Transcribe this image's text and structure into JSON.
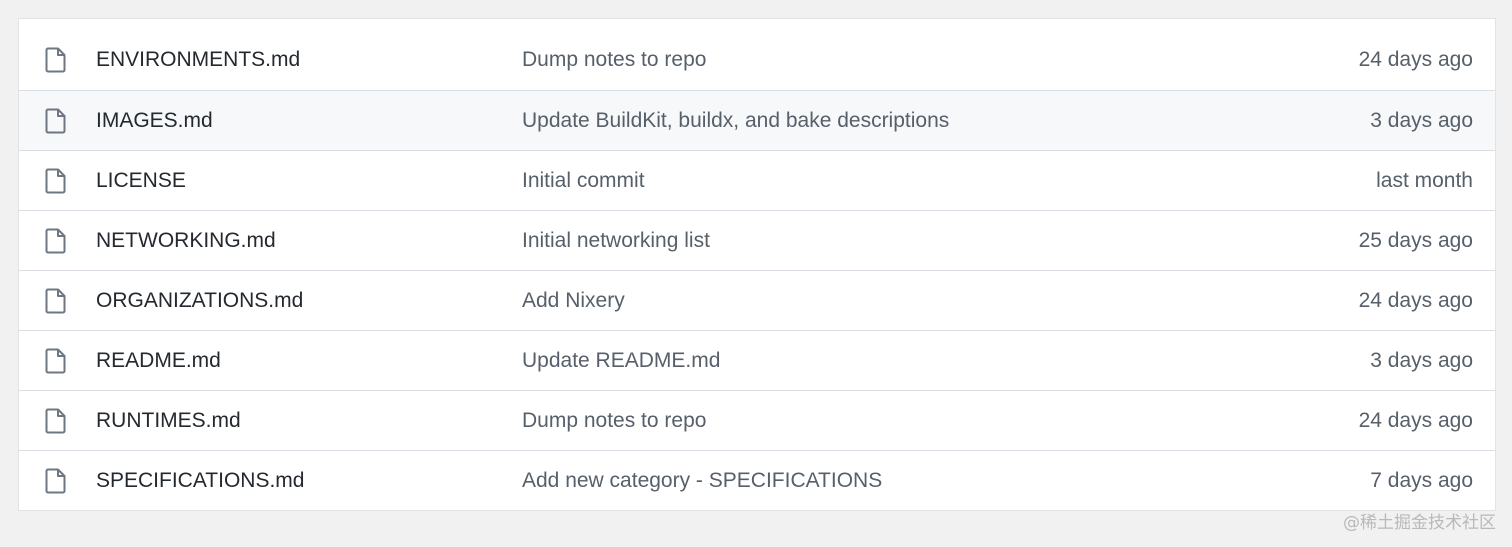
{
  "files": [
    {
      "icon": "file-icon",
      "name": "ENVIRONMENTS.md",
      "message": "Dump notes to repo",
      "age": "24 days ago"
    },
    {
      "icon": "file-icon",
      "name": "IMAGES.md",
      "message": "Update BuildKit, buildx, and bake descriptions",
      "age": "3 days ago"
    },
    {
      "icon": "file-icon",
      "name": "LICENSE",
      "message": "Initial commit",
      "age": "last month"
    },
    {
      "icon": "file-icon",
      "name": "NETWORKING.md",
      "message": "Initial networking list",
      "age": "25 days ago"
    },
    {
      "icon": "file-icon",
      "name": "ORGANIZATIONS.md",
      "message": "Add Nixery",
      "age": "24 days ago"
    },
    {
      "icon": "file-icon",
      "name": "README.md",
      "message": "Update README.md",
      "age": "3 days ago"
    },
    {
      "icon": "file-icon",
      "name": "RUNTIMES.md",
      "message": "Dump notes to repo",
      "age": "24 days ago"
    },
    {
      "icon": "file-icon",
      "name": "SPECIFICATIONS.md",
      "message": "Add new category - SPECIFICATIONS",
      "age": "7 days ago"
    }
  ],
  "hovered_row": 1,
  "watermark": "@稀土掘金技术社区",
  "colors": {
    "file_name": "#24292f",
    "secondary_text": "#57606a",
    "row_border": "#d8dee4",
    "hover_background": "#f6f8fa"
  }
}
